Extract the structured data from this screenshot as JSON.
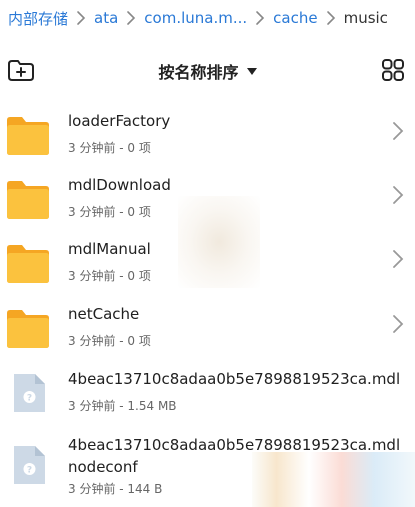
{
  "breadcrumb": {
    "items": [
      "内部存储",
      "ata",
      "com.luna.m...",
      "cache",
      "music"
    ]
  },
  "toolbar": {
    "sort_label": "按名称排序",
    "icons": [
      "new-folder-icon",
      "grid-view-icon"
    ]
  },
  "files": [
    {
      "name": "loaderFactory",
      "meta": "3 分钟前 - 0 项",
      "type": "folder"
    },
    {
      "name": "mdlDownload",
      "meta": "3 分钟前 - 0 项",
      "type": "folder"
    },
    {
      "name": "mdlManual",
      "meta": "3 分钟前 - 0 项",
      "type": "folder"
    },
    {
      "name": "netCache",
      "meta": "3 分钟前 - 0 项",
      "type": "folder"
    },
    {
      "name": "4beac13710c8adaa0b5e7898819523ca.mdl",
      "meta": "3 分钟前 - 1.54 MB",
      "type": "file"
    },
    {
      "name": "4beac13710c8adaa0b5e7898819523ca.mdlnodeconf",
      "meta": "3 分钟前 - 144 B",
      "type": "file"
    }
  ],
  "colors": {
    "accent": "#2a79d6",
    "folder": "#f7b93a",
    "folder_tab": "#f5a623",
    "file_icon": "#cdd9e6"
  }
}
